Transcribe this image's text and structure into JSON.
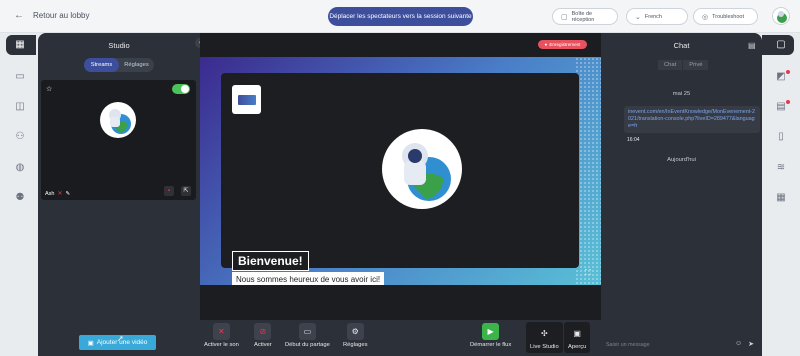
{
  "topbar": {
    "back_label": "Retour au lobby",
    "move_button": "Déplacer les spectateurs vers la session suivante",
    "inbox": "Boîte de réception",
    "language": "French",
    "troubleshoot": "Troubleshoot"
  },
  "icons": {
    "back": "arrow-left-icon",
    "inbox": "chat-bubble-icon",
    "language": "chevron-down-icon",
    "troubleshoot": "support-icon"
  },
  "studio": {
    "title": "Studio",
    "tabs": [
      "Streams",
      "Réglages"
    ],
    "stream": {
      "name": "Ash",
      "enabled": true
    },
    "add_video": "Ajouter une vidéo"
  },
  "stage": {
    "recording": "Enregistrement",
    "welcome_title": "Bienvenue!",
    "welcome_sub": "Nous sommes heureux de vous avoir ici!"
  },
  "controls": {
    "unmute": "Activer le son",
    "activate": "Activer",
    "share": "Début du partage",
    "settings": "Réglages",
    "start_stream": "Démarrer le flux",
    "live_studio": "Live Studio",
    "preview": "Aperçu"
  },
  "chat": {
    "title": "Chat",
    "tabs": [
      "Chat",
      "Privé"
    ],
    "date1": "mai 25",
    "message": "inevent.com/en/InEventKnowledge/MonEvenement-2021/translation-console.php?liveID=289477&language=fr",
    "message_time": "16:04",
    "date2": "Aujourd'hui",
    "input_placeholder": "Saisir un message"
  },
  "colors": {
    "primary": "#3d4e9c",
    "panel": "#2c3038",
    "accent_blue": "#38a9d9",
    "record_red": "#e8525e",
    "go_green": "#3cb34b"
  }
}
